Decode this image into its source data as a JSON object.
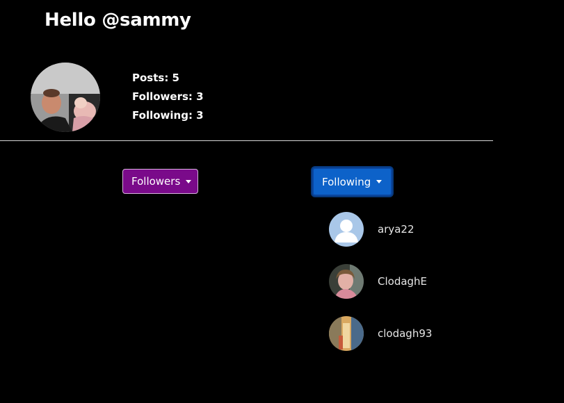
{
  "header": {
    "greeting": "Hello @sammy"
  },
  "profile": {
    "avatar_icon": "profile-photo",
    "stats": {
      "posts": "Posts: 5",
      "followers": "Followers: 3",
      "following": "Following: 3"
    }
  },
  "buttons": {
    "followers_label": "Followers",
    "following_label": "Following"
  },
  "following_list": [
    {
      "username": "arya22",
      "avatar_icon": "default-user-icon"
    },
    {
      "username": "ClodaghE",
      "avatar_icon": "user-photo"
    },
    {
      "username": "clodagh93",
      "avatar_icon": "user-photo"
    }
  ],
  "colors": {
    "background": "#000000",
    "followers_button": "#7a0a8a",
    "following_button": "#0d62c9",
    "text": "#ffffff"
  }
}
